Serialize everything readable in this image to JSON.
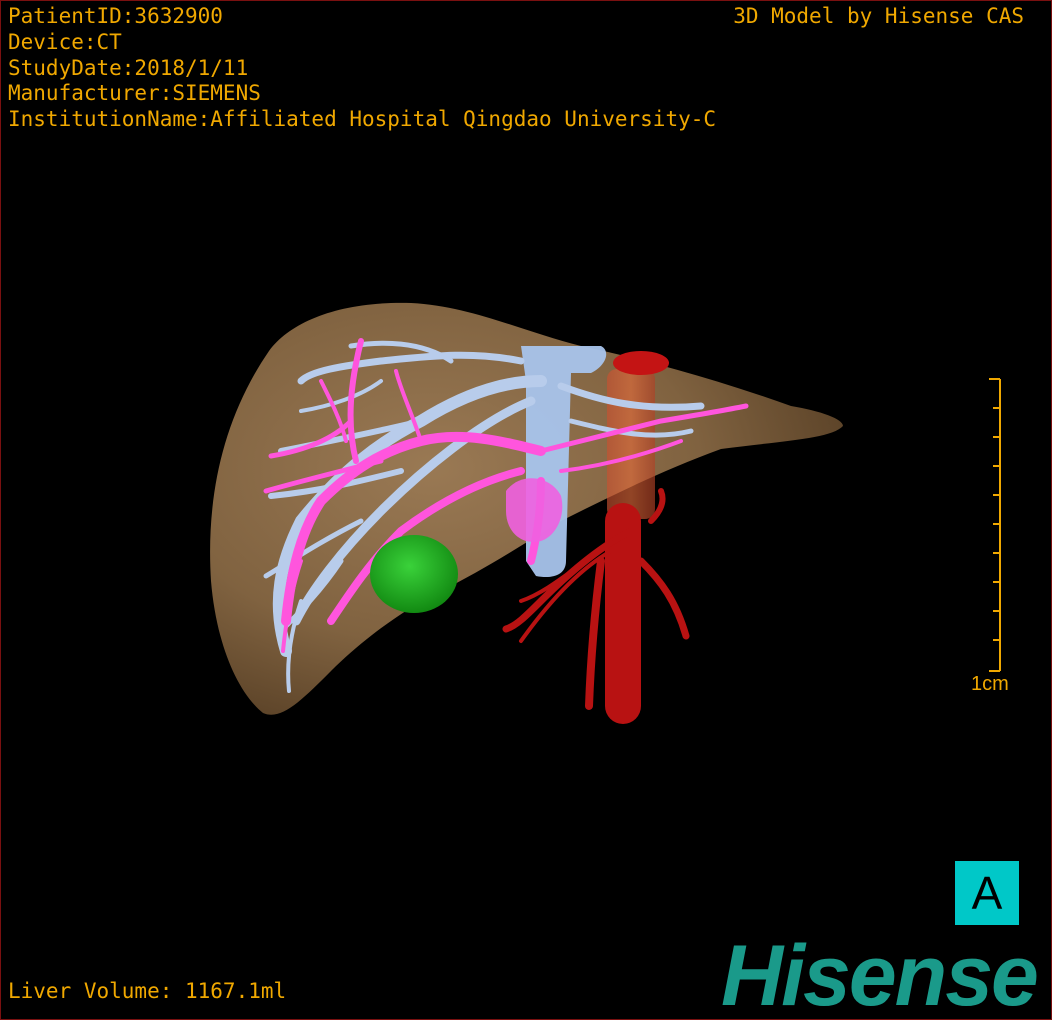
{
  "header": {
    "patient_id": "PatientID:3632900",
    "device": "Device:CT",
    "study_date": "StudyDate:2018/1/11",
    "manufacturer": "Manufacturer:SIEMENS",
    "institution": "InstitutionName:Affiliated Hospital Qingdao University-C",
    "model_credit": "3D Model by Hisense CAS"
  },
  "footer": {
    "liver_volume": "Liver Volume: 1167.1ml",
    "brand": "Hisense"
  },
  "scale": {
    "label": "1cm"
  },
  "orientation": {
    "label": "A"
  },
  "colors": {
    "text": "#f0a800",
    "liver": "#8a6a45",
    "portal_vein": "#b8c8e8",
    "hepatic_vessel": "#ff55dd",
    "artery": "#b81212",
    "lesion": "#1fb51f",
    "orientation_box": "#00c8c8",
    "brand": "#1a9a8a"
  }
}
